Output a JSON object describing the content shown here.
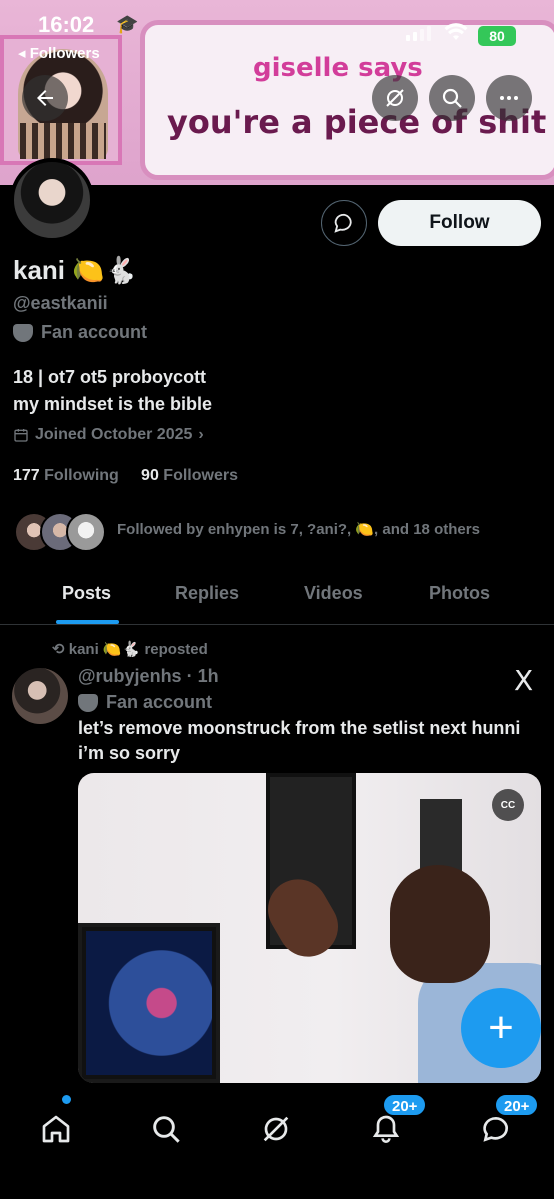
{
  "status": {
    "time": "16:02",
    "back_label": "◂ Followers",
    "battery": "80"
  },
  "banner": {
    "line1": "giselle says",
    "line2": "you're a piece of shit"
  },
  "profile": {
    "display_name": "kani 🍋🐇",
    "handle": "@eastkanii",
    "label": "Fan account",
    "bio_line1": "18 | ot7 ot5 proboycott",
    "bio_line2": "my mindset is the bible",
    "joined": "Joined October 2025",
    "following_count": "177",
    "following_label": "Following",
    "followers_count": "90",
    "followers_label": "Followers",
    "followed_by": "Followed by enhypen is 7, ?ani?, 🍋, and 18 others",
    "follow_button": "Follow"
  },
  "tabs": [
    "Posts",
    "Replies",
    "Videos",
    "Photos"
  ],
  "post": {
    "repost_line": "kani 🍋🐇 reposted",
    "handle_time": "@rubyjenhs · 1h",
    "label": "Fan account",
    "text": "let’s remove moonstruck from the setlist next hunni i’m so sorry",
    "x_logo": "X"
  },
  "nav": {
    "notif_badge": "20+",
    "msg_badge": "20+"
  },
  "colors": {
    "accent": "#1d9bf0",
    "muted": "#71767b"
  }
}
